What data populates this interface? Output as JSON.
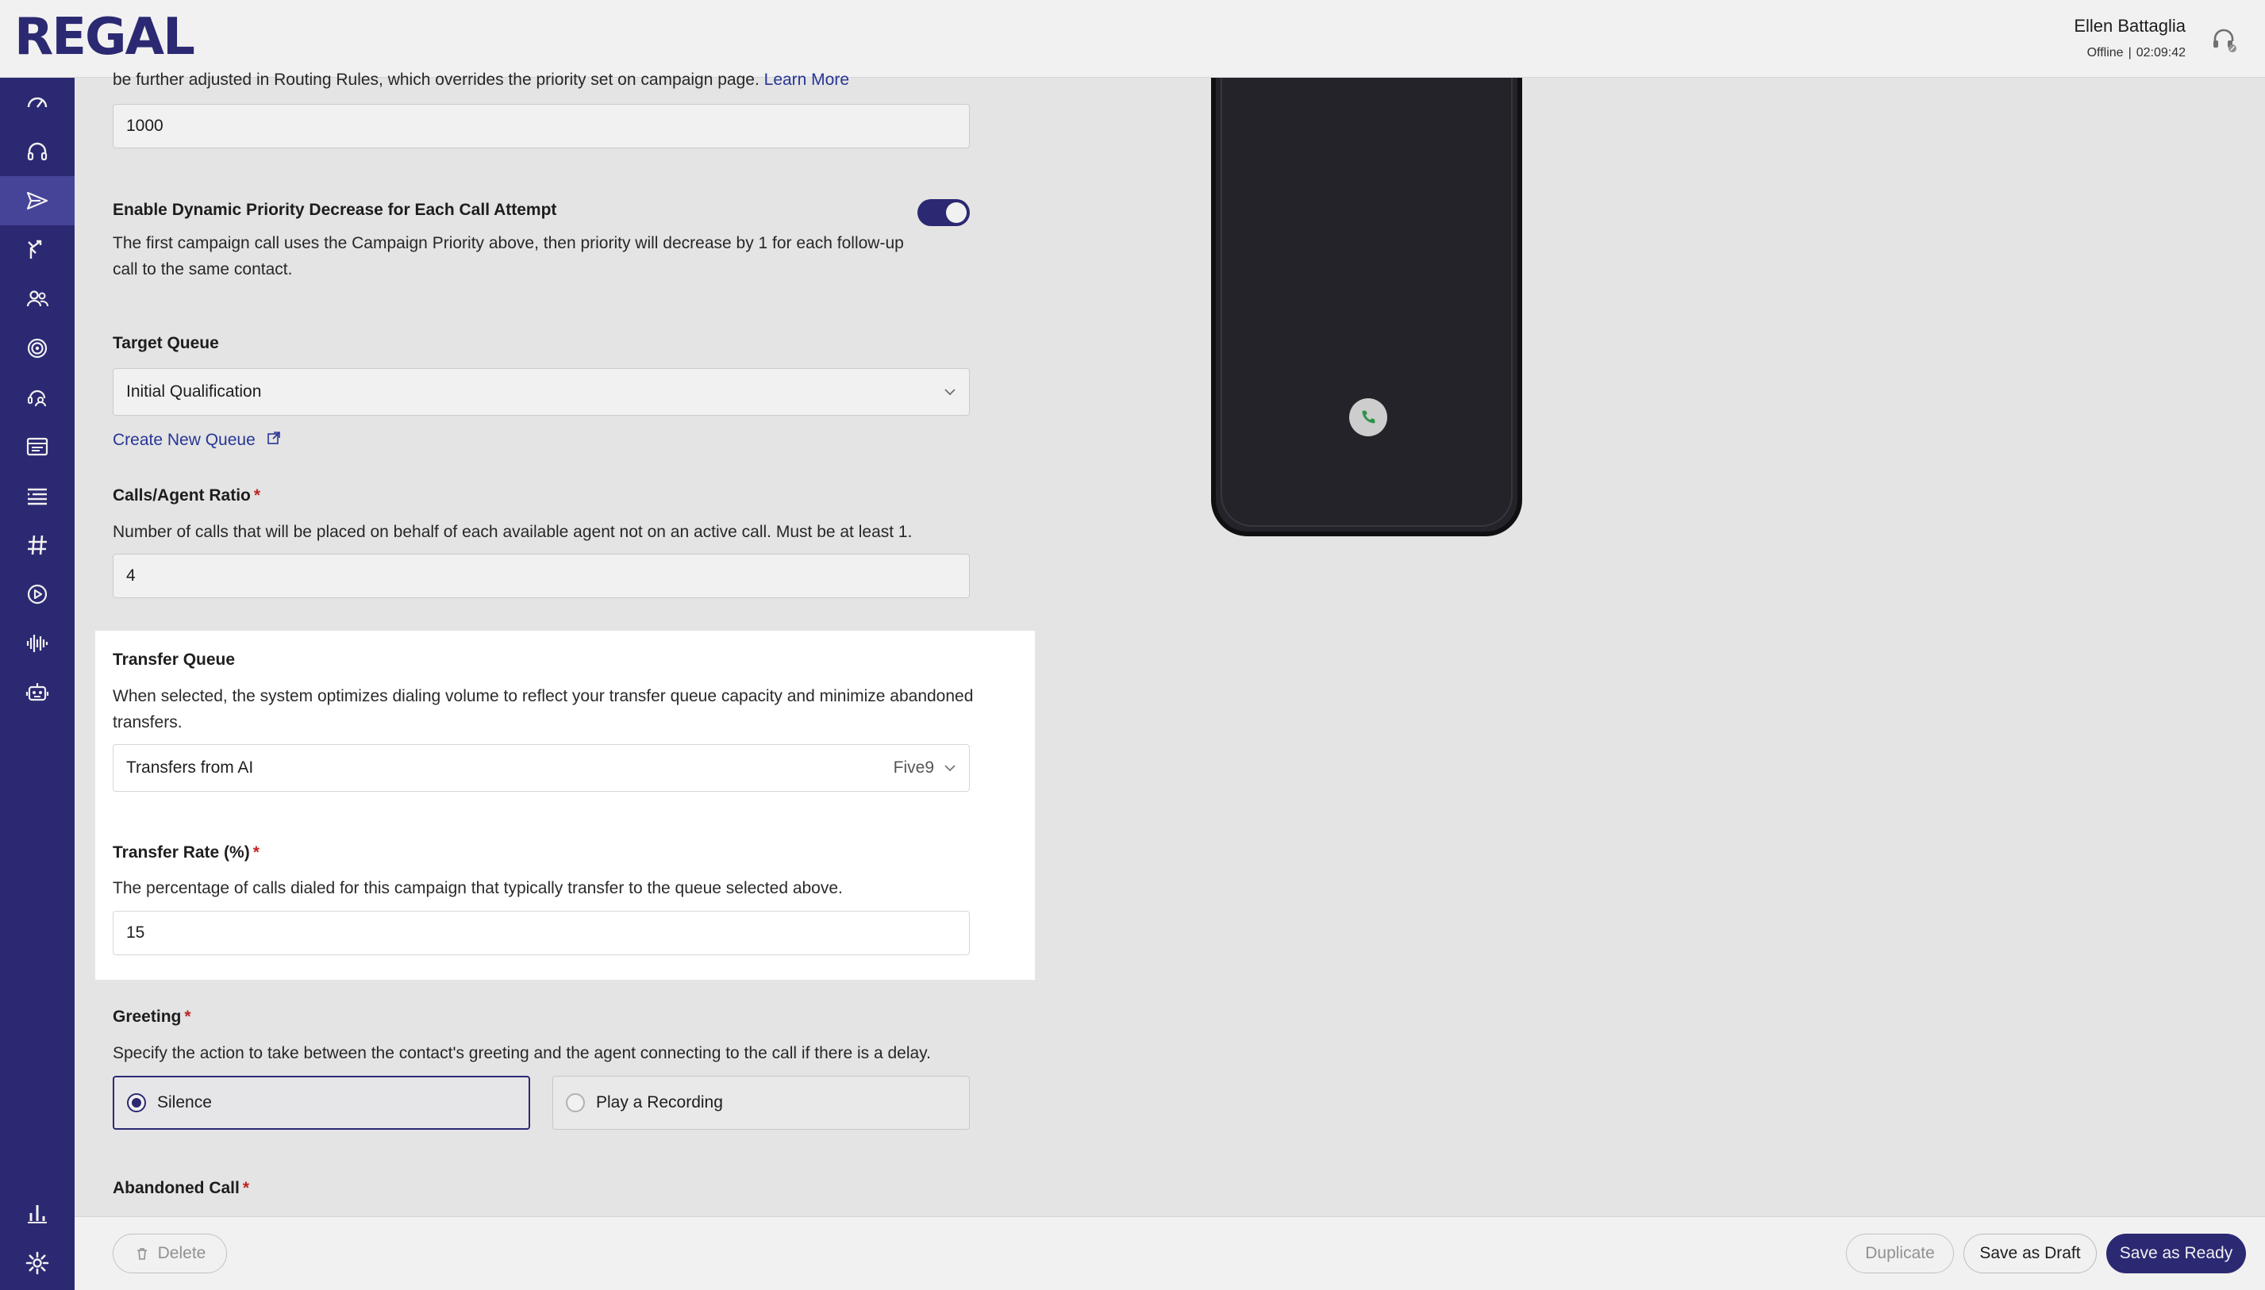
{
  "header": {
    "logo_text": "REGAL",
    "user_name": "Ellen Battaglia",
    "status": "Offline",
    "status_separator": "|",
    "timer": "02:09:42",
    "headset_icon": "headset-icon"
  },
  "sidebar": {
    "items": [
      {
        "icon": "dashboard-icon"
      },
      {
        "icon": "headset-icon"
      },
      {
        "icon": "send-icon",
        "active": true
      },
      {
        "icon": "branch-icon"
      },
      {
        "icon": "users-icon"
      },
      {
        "icon": "target-icon"
      },
      {
        "icon": "agent-icon"
      },
      {
        "icon": "list-card-icon"
      },
      {
        "icon": "list-icon"
      },
      {
        "icon": "hash-icon"
      },
      {
        "icon": "play-icon"
      },
      {
        "icon": "waveform-icon"
      },
      {
        "icon": "robot-icon"
      },
      {
        "icon": "bar-chart-icon"
      },
      {
        "icon": "settings-icon"
      }
    ]
  },
  "form": {
    "priority": {
      "desc_tail": "be further adjusted in Routing Rules, which overrides the priority set on campaign page.",
      "learn_more": "Learn More",
      "value": "1000"
    },
    "dynamic_priority": {
      "label": "Enable Dynamic Priority Decrease for Each Call Attempt",
      "desc_line1": "The first campaign call uses the Campaign Priority above, then priority will decrease by 1 for each follow-up",
      "desc_line2": "call to the same contact.",
      "enabled": true
    },
    "target_queue": {
      "label": "Target Queue",
      "value": "Initial Qualification",
      "create_link": "Create New Queue"
    },
    "calls_agent_ratio": {
      "label": "Calls/Agent Ratio",
      "required": "*",
      "desc": "Number of calls that will be placed on behalf of each available agent not on an active call. Must be at least 1.",
      "value": "4"
    },
    "transfer_queue": {
      "label": "Transfer Queue",
      "desc_line1": "When selected, the system optimizes dialing volume to reflect your transfer queue capacity and minimize abandoned",
      "desc_line2": "transfers.",
      "value": "Transfers from AI",
      "provider": "Five9"
    },
    "transfer_rate": {
      "label": "Transfer Rate (%)",
      "required": "*",
      "desc": "The percentage of calls dialed for this campaign that typically transfer to the queue selected above.",
      "value": "15"
    },
    "greeting": {
      "label": "Greeting",
      "required": "*",
      "desc": "Specify the action to take between the contact's greeting and the agent connecting to the call if there is a delay.",
      "options": [
        "Silence",
        "Play a Recording"
      ],
      "selected": "Silence"
    },
    "abandoned_call": {
      "label": "Abandoned Call",
      "required": "*"
    }
  },
  "footer": {
    "delete": "Delete",
    "duplicate": "Duplicate",
    "save_draft": "Save as Draft",
    "save_ready": "Save as Ready"
  },
  "colors": {
    "brand": "#2f2c7a",
    "active_nav": "#4b48a2",
    "link": "#2a3a9e",
    "required": "#c62828",
    "call_green": "#2e9d4e"
  }
}
